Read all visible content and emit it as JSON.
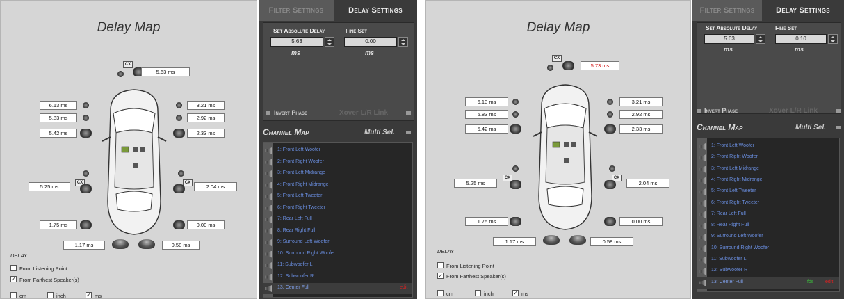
{
  "panels": [
    {
      "title": "Delay Map",
      "center_delay": "5.63 ms",
      "center_red": false,
      "cx_top": "CX",
      "cx_mid": "CX",
      "delays": {
        "front_left_woofer": "6.13 ms",
        "front_left_mid": "5.83 ms",
        "front_left_tweet": "5.42 ms",
        "front_right_woofer": "3.21 ms",
        "front_right_mid": "2.92 ms",
        "front_right_tweet": "2.33 ms",
        "surround_left": "5.25 ms",
        "surround_right": "2.04 ms",
        "rear_left": "1.75 ms",
        "rear_right": "0.00 ms",
        "sub_left": "1.17 ms",
        "sub_right": "0.58 ms"
      },
      "delay_label": "DELAY",
      "options": [
        "From Listening Point",
        "From Farthest Speaker(s)"
      ],
      "units": [
        "cm",
        "inch",
        "ms"
      ],
      "tabs": {
        "filter": "Filter Settings",
        "delay": "Delay Settings"
      },
      "abs_label": "Set Absolute Delay",
      "fine_label": "Fine Set",
      "abs_value": "5.63",
      "fine_value": "0.00",
      "unit_ms": "ms",
      "invert_phase": "Invert Phase",
      "xover_link": "Xover L/R Link",
      "channel_map": "Channel Map",
      "multi_sel": "Multi Sel.",
      "channels": [
        "1: Front Left Woofer",
        "2: Front Right Woofer",
        "3: Front Left Midrange",
        "4: Front Right Midrange",
        "5: Front Left Tweeter",
        "6: Front Right Tweeter",
        "7: Rear Left Full",
        "8: Rear Right Full",
        "9: Surround Left Woofer",
        "10: Surround Right Woofer",
        "11: Subwoofer L",
        "12: Subwoofer R",
        "13: Center Full"
      ],
      "edit": "edit",
      "fds": ""
    },
    {
      "title": "Delay Map",
      "center_delay": "5.73 ms",
      "center_red": true,
      "cx_top": "CX",
      "cx_mid": "CX",
      "delays": {
        "front_left_woofer": "6.13 ms",
        "front_left_mid": "5.83 ms",
        "front_left_tweet": "5.42 ms",
        "front_right_woofer": "3.21 ms",
        "front_right_mid": "2.92 ms",
        "front_right_tweet": "2.33 ms",
        "surround_left": "5.25 ms",
        "surround_right": "2.04 ms",
        "rear_left": "1.75 ms",
        "rear_right": "0.00 ms",
        "sub_left": "1.17 ms",
        "sub_right": "0.58 ms"
      },
      "delay_label": "DELAY",
      "options": [
        "From Listening Point",
        "From Farthest Speaker(s)"
      ],
      "units": [
        "cm",
        "inch",
        "ms"
      ],
      "tabs": {
        "filter": "Filter Settings",
        "delay": "Delay Settings"
      },
      "abs_label": "Set Absolute Delay",
      "fine_label": "Fine Set",
      "abs_value": "5.63",
      "fine_value": "0.10",
      "unit_ms": "ms",
      "invert_phase": "Invert Phase",
      "xover_link": "Xover L/R Link",
      "channel_map": "Channel Map",
      "multi_sel": "Multi Sel.",
      "channels": [
        "1: Front Left Woofer",
        "2: Front Right Woofer",
        "3: Front Left Midrange",
        "4: Front Right Midrange",
        "5: Front Left Tweeter",
        "6: Front Right Tweeter",
        "7: Rear Left Full",
        "8: Rear Right Full",
        "9: Surround Left Woofer",
        "10: Surround Right Woofer",
        "11: Subwoofer L",
        "12: Subwoofer R",
        "13: Center Full"
      ],
      "edit": "edit",
      "fds": "fds"
    }
  ]
}
